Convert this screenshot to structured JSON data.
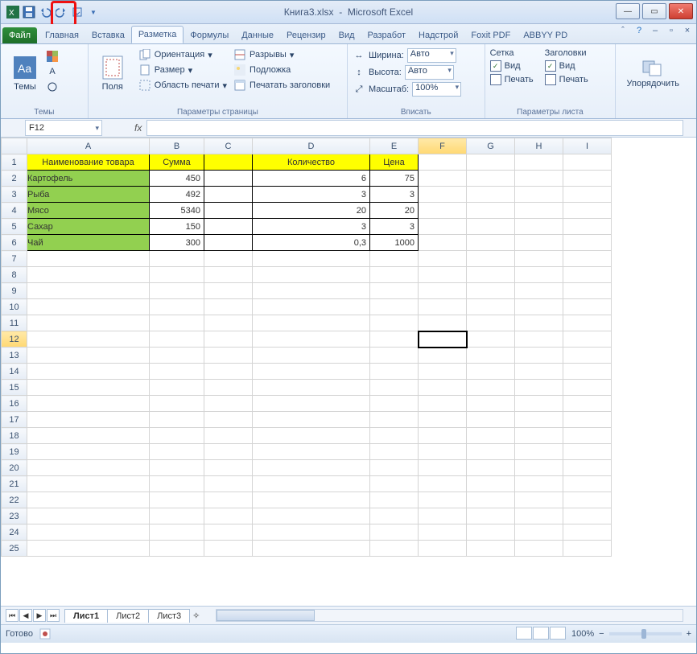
{
  "title_file": "Книга3.xlsx",
  "title_app": "Microsoft Excel",
  "ribbon": {
    "file": "Файл",
    "tabs": [
      "Главная",
      "Вставка",
      "Разметка",
      "Формулы",
      "Данные",
      "Рецензир",
      "Вид",
      "Разработ",
      "Надстрой",
      "Foxit PDF",
      "ABBYY PD"
    ],
    "active_index": 2,
    "groups": {
      "themes": {
        "big": "Темы",
        "label": "Темы"
      },
      "page": {
        "big": "Поля",
        "orientation": "Ориентация",
        "size": "Размер",
        "area": "Область печати",
        "breaks": "Разрывы",
        "background": "Подложка",
        "titles": "Печатать заголовки",
        "label": "Параметры страницы"
      },
      "fit": {
        "width": "Ширина:",
        "height": "Высота:",
        "scale": "Масштаб:",
        "auto": "Авто",
        "pct": "100%",
        "label": "Вписать"
      },
      "sheet": {
        "grid": "Сетка",
        "headings": "Заголовки",
        "view": "Вид",
        "print": "Печать",
        "label": "Параметры листа"
      },
      "arrange": {
        "big": "Упорядочить"
      }
    }
  },
  "namebox": "F12",
  "columns": [
    "A",
    "B",
    "C",
    "D",
    "E",
    "F",
    "G",
    "H",
    "I"
  ],
  "headers": {
    "a": "Наименование товара",
    "b": "Сумма",
    "d": "Количество",
    "e": "Цена"
  },
  "rows": [
    {
      "name": "Картофель",
      "b": "450",
      "d": "6",
      "e": "75"
    },
    {
      "name": "Рыба",
      "b": "492",
      "d": "3",
      "e": "3"
    },
    {
      "name": "Мясо",
      "b": "5340",
      "d": "20",
      "e": "20"
    },
    {
      "name": "Сахар",
      "b": "150",
      "d": "3",
      "e": "3"
    },
    {
      "name": "Чай",
      "b": "300",
      "d": "0,3",
      "e": "1000"
    }
  ],
  "sel_row": 12,
  "sheets": [
    "Лист1",
    "Лист2",
    "Лист3"
  ],
  "status": "Готово",
  "zoom": "100%",
  "zbtn_minus": "−",
  "zbtn_plus": "+",
  "chart_data": {
    "type": "table",
    "columns": [
      "Наименование товара",
      "Сумма",
      "Количество",
      "Цена"
    ],
    "rows": [
      [
        "Картофель",
        450,
        6,
        75
      ],
      [
        "Рыба",
        492,
        3,
        3
      ],
      [
        "Мясо",
        5340,
        20,
        20
      ],
      [
        "Сахар",
        150,
        3,
        3
      ],
      [
        "Чай",
        300,
        0.3,
        1000
      ]
    ]
  }
}
